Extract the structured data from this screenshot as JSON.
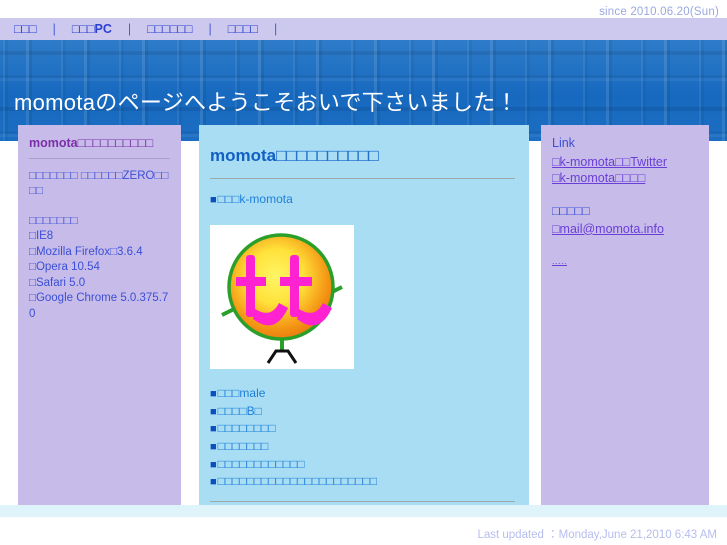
{
  "topbar": {
    "since_text": "since 2010.06.20(Sun)"
  },
  "nav": {
    "separator": "|",
    "items": [
      {
        "label": "□□□"
      },
      {
        "label": "□□□PC"
      },
      {
        "label": "□□□□□□"
      },
      {
        "label": "□□□□"
      }
    ]
  },
  "banner": {
    "title": "momotaのページへようこそおいで下さいました！",
    "bg_color": "#1f6fc4",
    "text_color": "#ffffff"
  },
  "left_column": {
    "bg_color": "#c7bce9",
    "title": "momota□□□□□□□□□□",
    "intro": "□□□□□□□ □□□□□□ZERO□□□□",
    "browsers_heading": "□□□□□□□",
    "browsers": [
      "□IE8",
      "□Mozilla Firefox□3.6.4",
      "□Opera 10.54",
      "□Safari 5.0",
      "□Google Chrome 5.0.375.70"
    ]
  },
  "main_column": {
    "bg_color": "#a8ddf4",
    "title": "momota□□□□□□□□□□",
    "bullet_glyph": "■",
    "name_line": "□□□k-momota",
    "image": {
      "alt_name": "momo-character-logo",
      "circle_outline_color": "#2aa02a",
      "circle_gradient_from": "#ffe94d",
      "circle_gradient_to": "#f08a1a",
      "text_color": "#ff22d0",
      "text": "もも",
      "bg_color": "#ffffff"
    },
    "profile_items": [
      "□□□male",
      "□□□□B□",
      "□□□□□□□□",
      "□□□□□□□",
      "□□□□□□□□□□□□",
      "□□□□□□□□□□□□□□□□□□□□□□"
    ]
  },
  "right_column": {
    "bg_color": "#c7bce9",
    "link_heading": "Link",
    "links": [
      "□k-momota□□Twitter",
      "□k-momota□□□□"
    ],
    "contact_label": "□□□□□",
    "contact_link": "□mail@momota.info",
    "small_link": "....."
  },
  "footer": {
    "last_updated": "Last updated  ：Monday,June 21,2010 6:43 AM"
  }
}
